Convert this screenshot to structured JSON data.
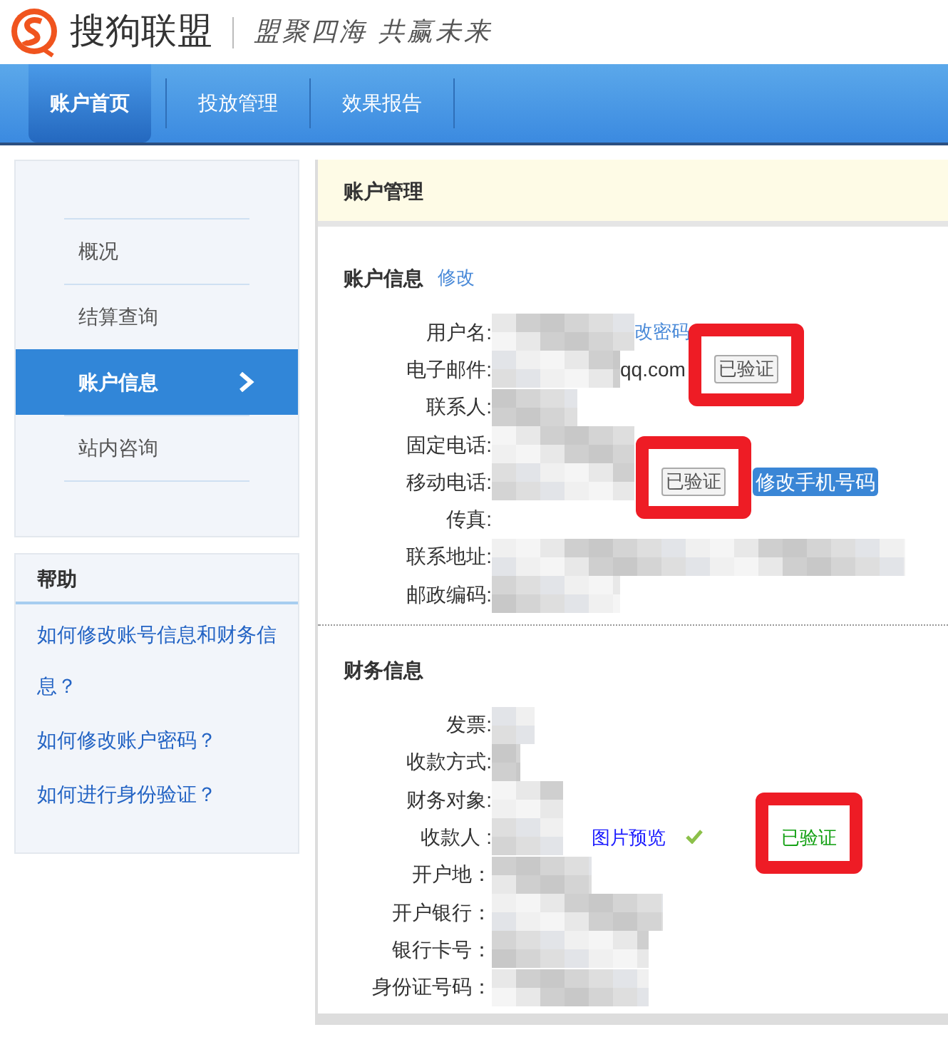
{
  "logo": {
    "name": "搜狗联盟",
    "slogan": "盟聚四海 共赢未来"
  },
  "nav": [
    {
      "label": "账户首页",
      "selected": true
    },
    {
      "label": "投放管理",
      "selected": false
    },
    {
      "label": "效果报告",
      "selected": false
    }
  ],
  "sidebar": {
    "items": [
      {
        "label": "概况",
        "selected": false
      },
      {
        "label": "结算查询",
        "selected": false
      },
      {
        "label": "账户信息",
        "selected": true
      },
      {
        "label": "站内咨询",
        "selected": false
      }
    ]
  },
  "help": {
    "title": "帮助",
    "links": [
      "如何修改账号信息和财务信息？",
      "如何修改账户密码？",
      "如何进行身份验证？"
    ]
  },
  "panel": {
    "title": "账户管理",
    "sections": [
      {
        "title": "账户信息",
        "edit_link": "修改",
        "rows": [
          {
            "label": "用户名:",
            "link": "改密码"
          },
          {
            "label": "电子邮件:",
            "value": "qq.com",
            "verified": {
              "kind": "badge",
              "label": "已验证",
              "highlighted": true
            }
          },
          {
            "label": "联系人:"
          },
          {
            "label": "固定电话:"
          },
          {
            "label": "移动电话:",
            "verified": {
              "kind": "badge",
              "label": "已验证",
              "highlighted": true
            },
            "action": "修改手机号码"
          },
          {
            "label": "传真:"
          },
          {
            "label": "联系地址:"
          },
          {
            "label": "邮政编码:"
          }
        ]
      },
      {
        "title": "财务信息",
        "rows": [
          {
            "label": "发票:"
          },
          {
            "label": "收款方式:"
          },
          {
            "label": "财务对象:"
          },
          {
            "label": "收款人 :",
            "link": "图片预览",
            "check": true,
            "verified": {
              "kind": "text",
              "label": "已验证",
              "highlighted": true
            }
          },
          {
            "label": "开户地："
          },
          {
            "label": "开户银行："
          },
          {
            "label": "银行卡号："
          },
          {
            "label": "身份证号码："
          }
        ]
      }
    ]
  }
}
